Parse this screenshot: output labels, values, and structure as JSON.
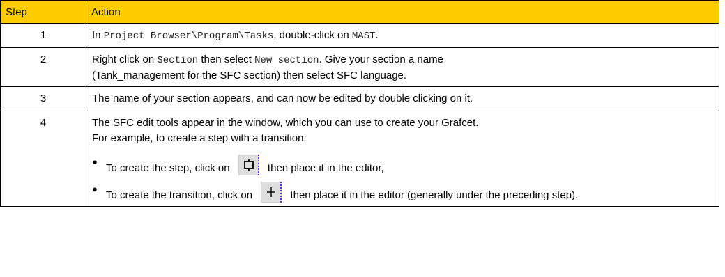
{
  "headers": {
    "step": "Step",
    "action": "Action"
  },
  "rows": [
    {
      "step": "1",
      "parts": {
        "t1": "In ",
        "c1": "Project Browser\\Program\\Tasks",
        "t2": ", double-click on ",
        "c2": "MAST",
        "t3": "."
      }
    },
    {
      "step": "2",
      "parts": {
        "t1": "Right click on ",
        "c1": "Section",
        "t2": " then select ",
        "c2": "New section",
        "t3": ". Give your section a name",
        "t4": "(Tank_management for the SFC section) then select SFC language."
      }
    },
    {
      "step": "3",
      "text": "The name of your section appears, and can now be edited by double clicking on it."
    },
    {
      "step": "4",
      "intro1": "The SFC edit tools appear in the window, which you can use to create your Grafcet.",
      "intro2": "For example, to create a step with a transition:",
      "bullet1": {
        "before": "To create the step, click on ",
        "after": " then place it in the editor,",
        "icon": "sfc-step-tool-icon"
      },
      "bullet2": {
        "before": "To create the transition, click on ",
        "after": " then place it in the editor (generally under the preceding step).",
        "icon": "sfc-transition-tool-icon"
      }
    }
  ],
  "colors": {
    "header_bg": "#ffcc00",
    "border": "#000000",
    "icon_bg": "#dedede",
    "icon_edge": "#6a2bd8"
  }
}
